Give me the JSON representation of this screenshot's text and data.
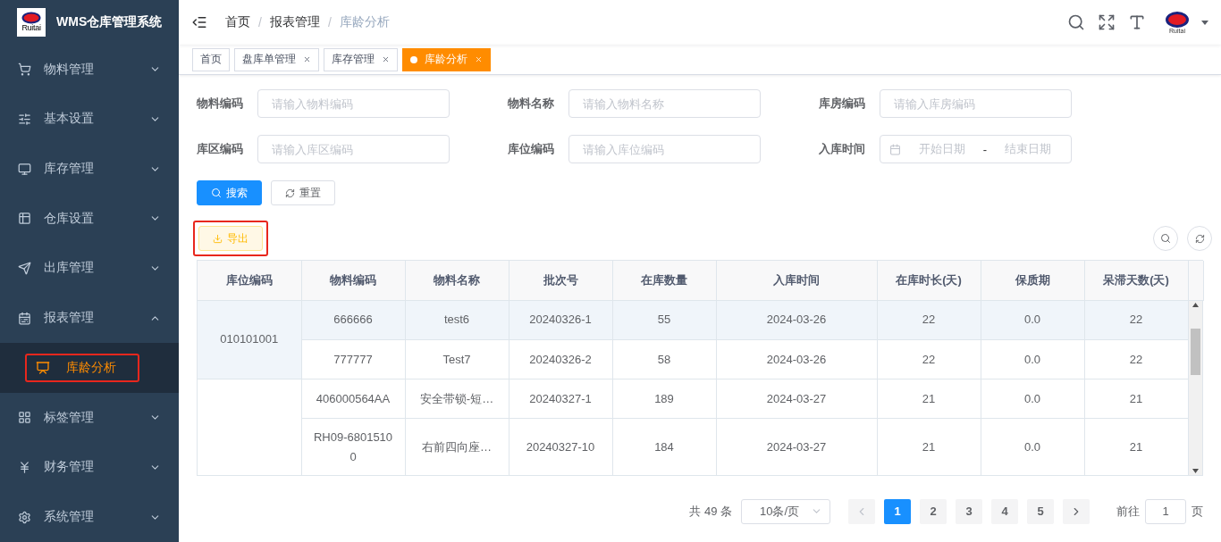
{
  "app": {
    "title": "WMS仓库管理系统",
    "logo_text": "Ruitai"
  },
  "sidebar": {
    "items": [
      {
        "label": "物料管理",
        "expanded": false
      },
      {
        "label": "基本设置",
        "expanded": false
      },
      {
        "label": "库存管理",
        "expanded": false
      },
      {
        "label": "仓库设置",
        "expanded": false
      },
      {
        "label": "出库管理",
        "expanded": false
      },
      {
        "label": "报表管理",
        "expanded": true,
        "children": [
          {
            "label": "库龄分析",
            "selected": true,
            "highlighted": true
          }
        ]
      },
      {
        "label": "标签管理",
        "expanded": false
      },
      {
        "label": "财务管理",
        "expanded": false
      },
      {
        "label": "系统管理",
        "expanded": false
      }
    ]
  },
  "breadcrumb": [
    "首页",
    "报表管理",
    "库龄分析"
  ],
  "breadcrumb_separator": "/",
  "header": {
    "avatar_text": "Ruitai"
  },
  "tabs": [
    {
      "label": "首页",
      "selected": false,
      "closable": false
    },
    {
      "label": "盘库单管理",
      "selected": false,
      "closable": true
    },
    {
      "label": "库存管理",
      "selected": false,
      "closable": true
    },
    {
      "label": "库龄分析",
      "selected": true,
      "closable": true
    }
  ],
  "filters": [
    {
      "kind": "text",
      "label": "物料编码",
      "placeholder": "请输入物料编码"
    },
    {
      "kind": "text",
      "label": "物料名称",
      "placeholder": "请输入物料名称"
    },
    {
      "kind": "text",
      "label": "库房编码",
      "placeholder": "请输入库房编码"
    },
    {
      "kind": "text",
      "label": "库区编码",
      "placeholder": "请输入库区编码"
    },
    {
      "kind": "text",
      "label": "库位编码",
      "placeholder": "请输入库位编码"
    },
    {
      "kind": "daterange",
      "label": "入库时间",
      "start_placeholder": "开始日期",
      "separator": "-",
      "end_placeholder": "结束日期"
    }
  ],
  "search_button": "搜索",
  "reset_button": "重置",
  "export_button": {
    "label": "导出",
    "highlighted": true
  },
  "table": {
    "columns": [
      "库位编码",
      "物料编码",
      "物料名称",
      "批次号",
      "在库数量",
      "入库时间",
      "在库时长(天)",
      "保质期",
      "呆滞天数(天)"
    ],
    "groups": [
      {
        "location": "010101001",
        "hovered": true,
        "rows": [
          {
            "hovered": true,
            "cells": [
              "666666",
              "test6",
              "20240326-1",
              "55",
              "2024-03-26",
              "22",
              "0.0",
              "22"
            ]
          },
          {
            "hovered": false,
            "cells": [
              "777777",
              "Test7",
              "20240326-2",
              "58",
              "2024-03-26",
              "22",
              "0.0",
              "22"
            ]
          }
        ]
      },
      {
        "hovered": false,
        "rows": [
          {
            "hovered": false,
            "cells": [
              "406000564AA",
              "安全带锁-短…",
              "20240327-1",
              "189",
              "2024-03-27",
              "21",
              "0.0",
              "21"
            ]
          },
          {
            "hovered": false,
            "cells": [
              "RH09-68015100",
              "右前四向座…",
              "20240327-10",
              "184",
              "2024-03-27",
              "21",
              "0.0",
              "21"
            ]
          }
        ]
      }
    ]
  },
  "pagination": {
    "total": "共 49 条",
    "page_size": "10条/页",
    "pages": [
      {
        "label": "1",
        "selected": true
      },
      {
        "label": "2",
        "selected": false
      },
      {
        "label": "3",
        "selected": false
      },
      {
        "label": "4",
        "selected": false
      },
      {
        "label": "5",
        "selected": false
      }
    ],
    "goto_label": "前往",
    "goto_value": "1",
    "page_suffix": "页"
  }
}
